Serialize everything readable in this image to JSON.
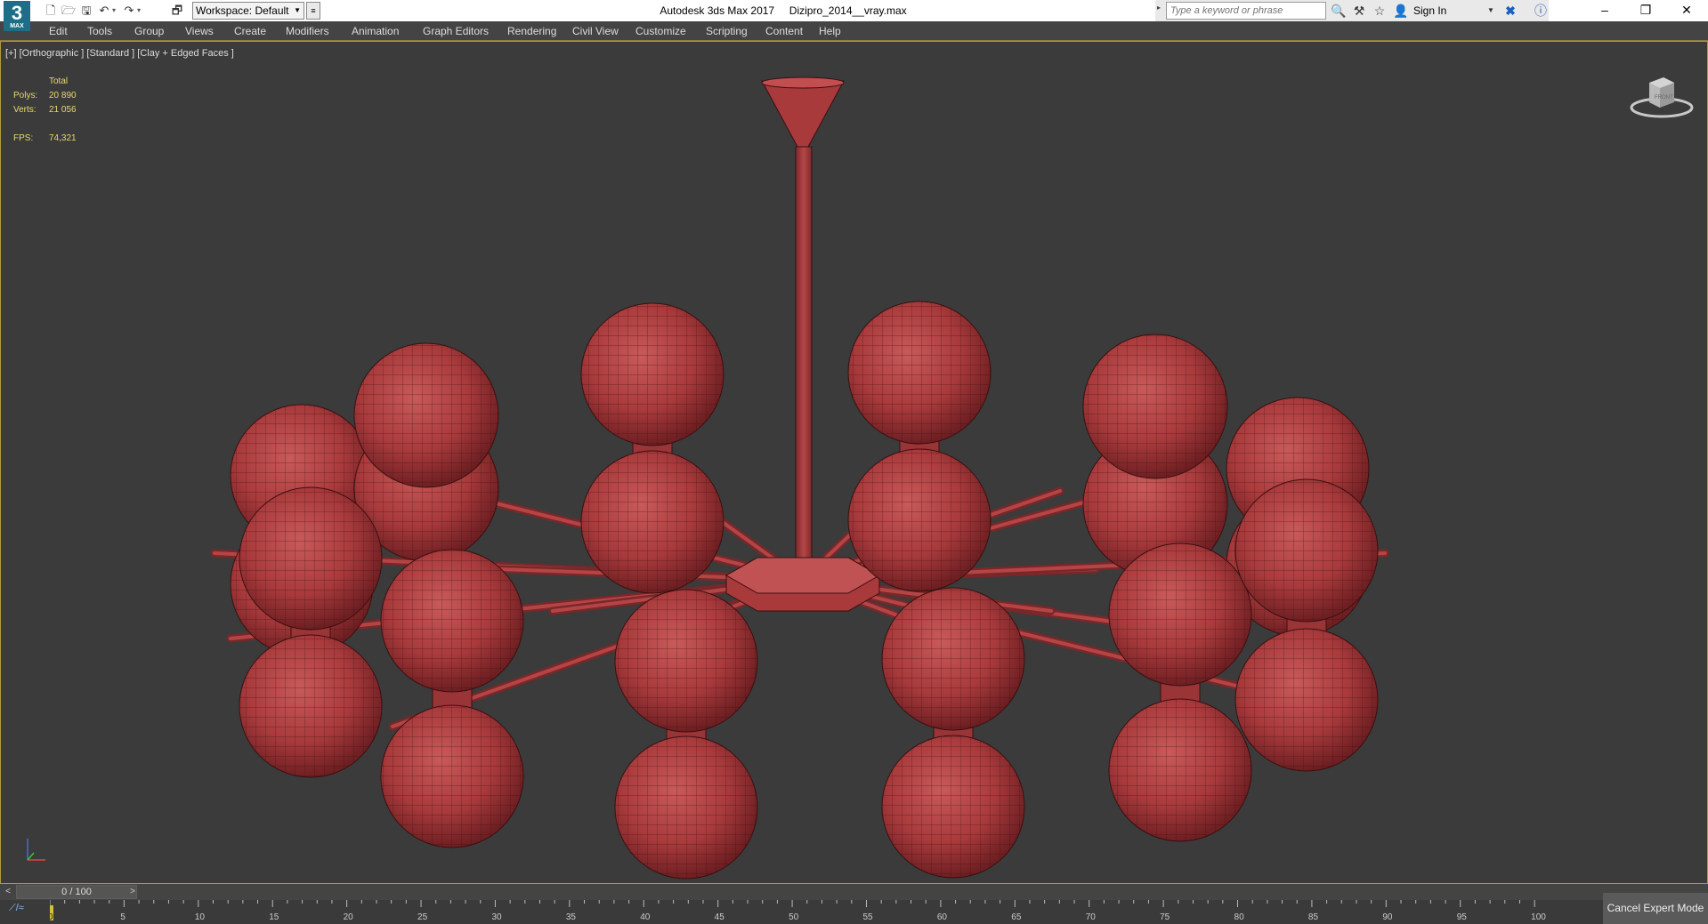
{
  "app": {
    "logo_text": "3",
    "logo_sub": "MAX",
    "title": "Autodesk 3ds Max 2017",
    "file_name": "Dizipro_2014__vray.max"
  },
  "quick_access": {
    "workspace_label": "Workspace: Default",
    "search_placeholder": "Type a keyword or phrase",
    "sign_in": "Sign In"
  },
  "menu": [
    {
      "label": "Edit"
    },
    {
      "label": "Tools"
    },
    {
      "label": "Group"
    },
    {
      "label": "Views"
    },
    {
      "label": "Create"
    },
    {
      "label": "Modifiers"
    },
    {
      "label": "Animation"
    },
    {
      "label": "Graph Editors"
    },
    {
      "label": "Rendering"
    },
    {
      "label": "Civil View"
    },
    {
      "label": "Customize"
    },
    {
      "label": "Scripting"
    },
    {
      "label": "Content"
    },
    {
      "label": "Help"
    }
  ],
  "viewport": {
    "label": "[+] [Orthographic ] [Standard ] [Clay + Edged Faces ]",
    "viewcube_face": "FRONT",
    "stats": {
      "total_label": "Total",
      "polys_label": "Polys:",
      "polys_value": "20 890",
      "verts_label": "Verts:",
      "verts_value": "21 056",
      "fps_label": "FPS:",
      "fps_value": "74,321"
    }
  },
  "timeline": {
    "frame_display": "0 / 100",
    "current_frame": "0",
    "ruler_labels": [
      "5",
      "10",
      "15",
      "20",
      "25",
      "30",
      "35",
      "40",
      "45",
      "50",
      "55",
      "60",
      "65",
      "70",
      "75",
      "80",
      "85",
      "90",
      "95",
      "100"
    ]
  },
  "expert_mode_button": "Cancel Expert Mode",
  "colors": {
    "viewport_bg": "#3b3b3b",
    "clay_object": "#a83a3c",
    "stats_text": "#e8d96b",
    "active_border": "#b09a3a"
  }
}
